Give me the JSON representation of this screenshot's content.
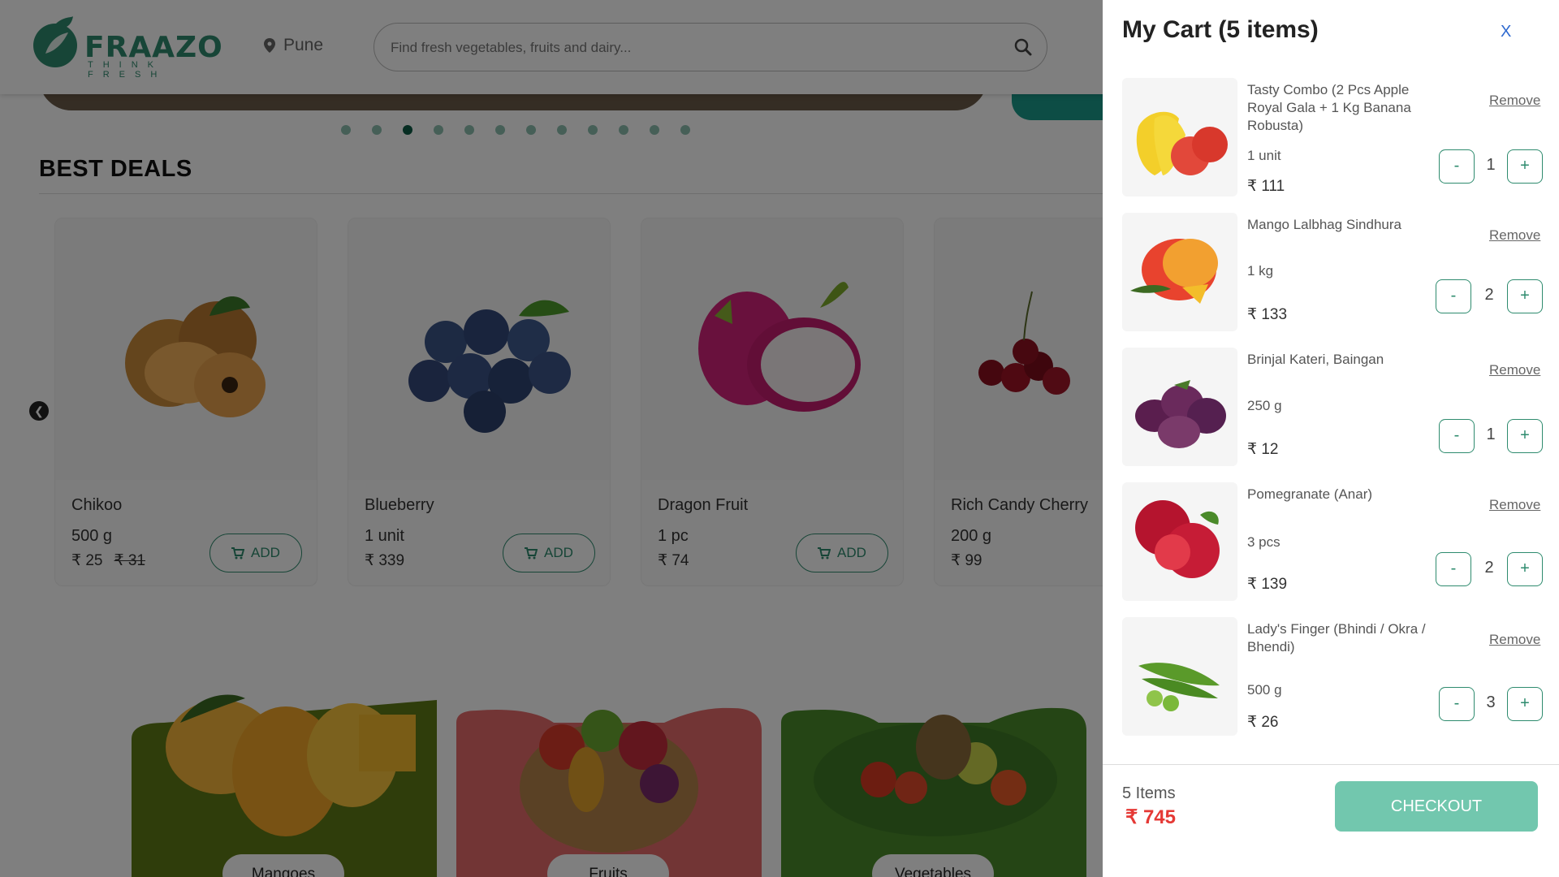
{
  "header": {
    "logo_text": "FRAAZO",
    "logo_tagline": "THINK FRESH",
    "location": "Pune",
    "search_placeholder": "Find fresh vegetables, fruits and dairy..."
  },
  "carousel": {
    "dot_count": 12,
    "active_index": 2
  },
  "best_deals": {
    "title": "BEST DEALS",
    "add_label": "ADD",
    "products": [
      {
        "name": "Chikoo",
        "unit": "500 g",
        "price": "₹ 25",
        "old_price": "₹ 31"
      },
      {
        "name": "Blueberry",
        "unit": "1 unit",
        "price": "₹ 339",
        "old_price": ""
      },
      {
        "name": "Dragon Fruit",
        "unit": "1 pc",
        "price": "₹ 74",
        "old_price": ""
      },
      {
        "name": "Rich Candy Cherry",
        "unit": "200 g",
        "price": "₹ 99",
        "old_price": ""
      }
    ]
  },
  "categories": [
    {
      "label": "Mangoes",
      "color": "#5e7a17"
    },
    {
      "label": "Fruits",
      "color": "#e56b6b"
    },
    {
      "label": "Vegetables",
      "color": "#4a8a2a"
    }
  ],
  "cart": {
    "title": "My Cart (5 items)",
    "close_label": "X",
    "remove_label": "Remove",
    "minus_label": "-",
    "plus_label": "+",
    "items": [
      {
        "name": "Tasty Combo (2 Pcs Apple Royal Gala + 1 Kg Banana Robusta)",
        "unit": "1 unit",
        "price": "₹ 111",
        "qty": "1"
      },
      {
        "name": "Mango Lalbhag Sindhura",
        "unit": "1 kg",
        "price": "₹ 133",
        "qty": "2"
      },
      {
        "name": "Brinjal Kateri, Baingan",
        "unit": "250 g",
        "price": "₹ 12",
        "qty": "1"
      },
      {
        "name": "Pomegranate (Anar)",
        "unit": "3 pcs",
        "price": "₹ 139",
        "qty": "2"
      },
      {
        "name": "Lady's Finger (Bhindi / Okra / Bhendi)",
        "unit": "500 g",
        "price": "₹ 26",
        "qty": "3"
      }
    ],
    "footer": {
      "count": "5 Items",
      "total": "₹ 745",
      "checkout_label": "CHECKOUT"
    }
  },
  "colors": {
    "brand": "#2e8b6e",
    "checkout": "#72c7ae",
    "total": "#e53935",
    "close": "#2f6ad0"
  }
}
